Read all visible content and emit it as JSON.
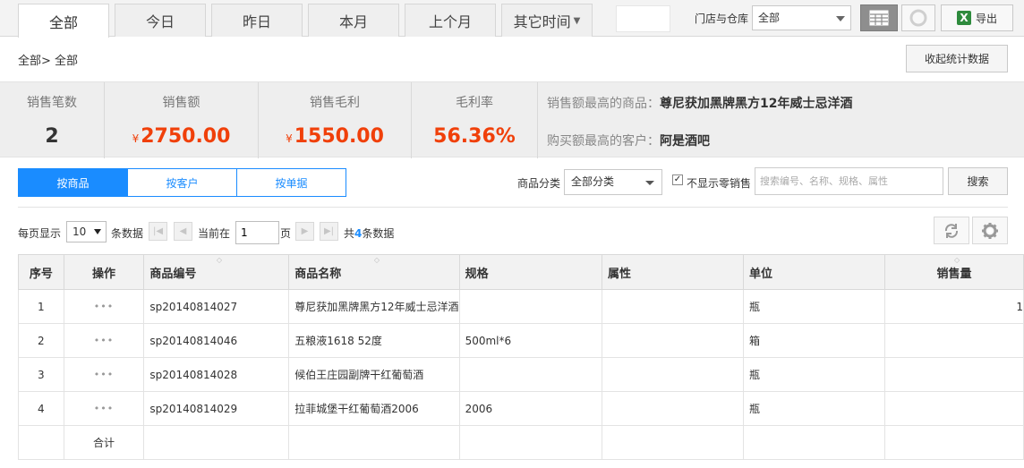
{
  "tabs": [
    {
      "label": "全部",
      "active": true
    },
    {
      "label": "今日"
    },
    {
      "label": "昨日"
    },
    {
      "label": "本月"
    },
    {
      "label": "上个月"
    },
    {
      "label": "其它时间"
    }
  ],
  "store_filter": {
    "label": "门店与仓库",
    "value": "全部"
  },
  "toolbar": {
    "export_label": "导出"
  },
  "breadcrumb": "全部> 全部",
  "collapse_label": "收起统计数据",
  "stats": {
    "count": {
      "label": "销售笔数",
      "value": "2"
    },
    "sales": {
      "label": "销售额",
      "currency": "¥",
      "value": "2750.00"
    },
    "profit": {
      "label": "销售毛利",
      "currency": "¥",
      "value": "1550.00"
    },
    "margin": {
      "label": "毛利率",
      "value": "56.36%"
    },
    "top_product": {
      "label": "销售额最高的商品：",
      "value": "尊尼获加黑牌黑方12年威士忌洋酒"
    },
    "top_customer": {
      "label": "购买额最高的客户：",
      "value": "阿是酒吧"
    }
  },
  "view_tabs": [
    {
      "label": "按商品",
      "active": true
    },
    {
      "label": "按客户"
    },
    {
      "label": "按单据"
    }
  ],
  "filters": {
    "category_label": "商品分类",
    "category_value": "全部分类",
    "hide_zero_checked": true,
    "hide_zero_label": "不显示零销售",
    "search_placeholder": "搜索编号、名称、规格、属性",
    "search_button": "搜索"
  },
  "pager": {
    "per_page_label": "每页显示",
    "per_page_value": "10",
    "records_label": "条数据",
    "current_label": "当前在",
    "current_page": "1",
    "page_label": "页",
    "total_prefix": "共",
    "total_count": "4",
    "total_suffix": "条数据"
  },
  "table": {
    "headers": [
      "序号",
      "操作",
      "商品编号",
      "商品名称",
      "规格",
      "属性",
      "单位",
      "销售量"
    ],
    "rows": [
      {
        "no": "1",
        "op": "•••",
        "code": "sp20140814027",
        "name": "尊尼获加黑牌黑方12年威士忌洋酒",
        "spec": "",
        "attr": "",
        "unit": "瓶",
        "qty": "1"
      },
      {
        "no": "2",
        "op": "•••",
        "code": "sp20140814046",
        "name": "五粮液1618 52度",
        "spec": "500ml*6",
        "attr": "",
        "unit": "箱",
        "qty": ""
      },
      {
        "no": "3",
        "op": "•••",
        "code": "sp20140814028",
        "name": "候伯王庄园副牌干红葡萄酒",
        "spec": "",
        "attr": "",
        "unit": "瓶",
        "qty": ""
      },
      {
        "no": "4",
        "op": "•••",
        "code": "sp20140814029",
        "name": "拉菲城堡干红葡萄酒2006",
        "spec": "2006",
        "attr": "",
        "unit": "瓶",
        "qty": ""
      }
    ],
    "total_label": "合计"
  }
}
